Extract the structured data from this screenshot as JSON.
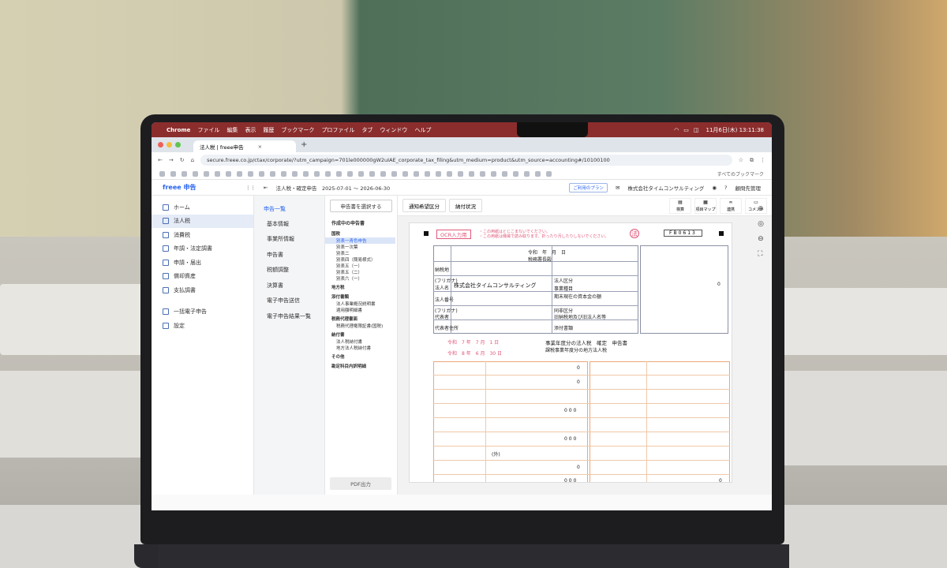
{
  "menubar": {
    "app": "Chrome",
    "items": [
      "ファイル",
      "編集",
      "表示",
      "履歴",
      "ブックマーク",
      "プロファイル",
      "タブ",
      "ウィンドウ",
      "ヘルプ"
    ],
    "clock": "11月6日(木) 13:11:38"
  },
  "browser": {
    "tab_title": "法人税 | freee申告",
    "url": "secure.freee.co.jp/ctax/corporate/?utm_campaign=701le000000gW2uIAE_corporate_tax_filing&utm_medium=product&utm_source=accounting#/10100100",
    "bookmarks_folder": "すべてのブックマーク"
  },
  "header": {
    "logo": "freee 申告",
    "period": "法人税・確定申告　2025-07-01 〜 2026-06-30",
    "plan": "ご利用のプラン",
    "company": "株式会社タイムコンサルティング",
    "user": "顧問先管理"
  },
  "nav": {
    "items": [
      "ホーム",
      "法人税",
      "消費税",
      "年調・法定調書",
      "申請・届出",
      "償却資産",
      "支払調書"
    ],
    "bottom": [
      "一括電子申告",
      "設定"
    ]
  },
  "sub": {
    "head": "申告一覧",
    "items": [
      "基本情報",
      "事業所情報",
      "申告書",
      "税額調整",
      "決算書",
      "電子申告送信",
      "電子申告結果一覧"
    ]
  },
  "docs": {
    "button": "申告書を選択する",
    "title": "作成中の申告書",
    "cat_kokuzei": "国税",
    "kokuzei": [
      "別表一青色申告",
      "別表一次葉",
      "別表二",
      "別表四（簡易様式）",
      "別表五（一）",
      "別表五（二）",
      "別表六（一）"
    ],
    "cat_chihou": "地方税",
    "cat_tenpu": "添付書類",
    "tenpu": [
      "法人事業概況説明書",
      "適用額明細書"
    ],
    "cat_zeiri": "税務代理書面",
    "zeiri": [
      "税務代理権限証書(国税)"
    ],
    "cat_nofu": "納付書",
    "nofu": [
      "法人税納付書",
      "地方法人税納付書"
    ],
    "cat_other": "その他",
    "cat_kanjo": "勘定科目内訳明細",
    "pdf": "PDF出力"
  },
  "toolbar": {
    "btn1": "通知希望区分",
    "btn2": "納付状況",
    "icons": [
      "検算",
      "項目マップ",
      "連携",
      "コメント"
    ]
  },
  "form": {
    "ocr": "OCR入力用",
    "warn1": "・この用紙はとじこまないでください。",
    "warn2": "・この用紙は機械で読み取ります。折ったり汚したりしないでください。",
    "hou": "法",
    "code": "FB0613",
    "era": "令和　年　月　日",
    "office": "税務署長殿",
    "company": "株式会社タイムコンサルティング",
    "labels_left": [
      "納税地",
      "(フリガナ)",
      "法人名",
      "法人番号",
      "(フリガナ)",
      "代表者",
      "代表者住所"
    ],
    "labels_right": [
      "法人区分",
      "事業種目",
      "期末現在の資本金の額",
      "同非区分",
      "旧納税地及び旧法人名等",
      "添付書類"
    ],
    "period_from": "令和　7 年　7 月　1 日",
    "period_to": "令和　8 年　6 月　30 日",
    "title": "事業年度分の法人税　確定　申告書",
    "title2": "課税事業年度分の地方法人税",
    "zero": "0",
    "zeros": "0 0 0",
    "gai": "(外)"
  }
}
